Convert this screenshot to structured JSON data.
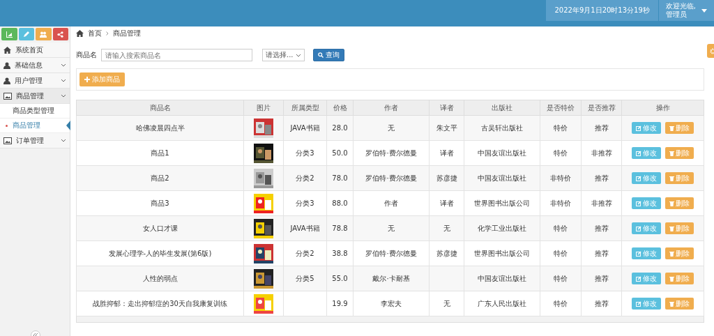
{
  "header": {
    "datetime": "2022年9月1日20时13分19秒",
    "greeting": "欢迎光临,",
    "user": "管理员"
  },
  "sidebar": {
    "shortcuts": [
      {
        "color": "#5cb85c"
      },
      {
        "color": "#5bc0de"
      },
      {
        "color": "#f0ad4e"
      },
      {
        "color": "#d9534f"
      }
    ],
    "menu": [
      {
        "label": "系统首页",
        "kind": "link"
      },
      {
        "label": "基础信息",
        "kind": "group",
        "expanded": false
      },
      {
        "label": "用户管理",
        "kind": "group",
        "expanded": false
      },
      {
        "label": "商品管理",
        "kind": "group",
        "expanded": true,
        "children": [
          {
            "label": "商品类型管理",
            "selected": false
          },
          {
            "label": "商品管理",
            "selected": true
          }
        ]
      },
      {
        "label": "订单管理",
        "kind": "group",
        "expanded": false
      }
    ]
  },
  "breadcrumb": [
    "首页",
    "商品管理"
  ],
  "search": {
    "label": "商品名",
    "placeholder": "请输入搜索商品名",
    "select": "请选择...",
    "button": "查询"
  },
  "add_button": "添加商品",
  "table": {
    "columns": [
      "商品名",
      "图片",
      "所属类型",
      "价格",
      "作者",
      "译者",
      "出版社",
      "是否特价",
      "是否推荐",
      "操作"
    ],
    "rows": [
      {
        "name": "哈佛凌晨四点半",
        "category": "JAVA书籍",
        "price": "28.0",
        "author": "无",
        "translator": "朱文平",
        "publisher": "古吴轩出版社",
        "special": "特价",
        "recommend": "推荐",
        "actions": [
          "修改",
          "删除"
        ]
      },
      {
        "name": "商品1",
        "category": "分类3",
        "price": "50.0",
        "author": "罗伯特·费尔德曼",
        "translator": "译者",
        "publisher": "中国友谊出版社",
        "special": "特价",
        "recommend": "非推荐",
        "actions": [
          "修改",
          "删除"
        ]
      },
      {
        "name": "商品2",
        "category": "分类2",
        "price": "78.0",
        "author": "罗伯特·费尔德曼",
        "translator": "苏彦捷",
        "publisher": "中国友谊出版社",
        "special": "非特价",
        "recommend": "推荐",
        "actions": [
          "修改",
          "删除"
        ]
      },
      {
        "name": "商品3",
        "category": "分类3",
        "price": "88.0",
        "author": "作者",
        "translator": "译者",
        "publisher": "世界图书出版公司",
        "special": "非特价",
        "recommend": "非推荐",
        "actions": [
          "修改",
          "删除"
        ]
      },
      {
        "name": "女人口才课",
        "category": "JAVA书籍",
        "price": "78.8",
        "author": "无",
        "translator": "无",
        "publisher": "化学工业出版社",
        "special": "特价",
        "recommend": "推荐",
        "actions": [
          "修改",
          "删除"
        ]
      },
      {
        "name": "发展心理学-人的毕生发展(第6版)",
        "category": "分类2",
        "price": "38.8",
        "author": "罗伯特·费尔德曼",
        "translator": "苏彦捷",
        "publisher": "世界图书出版公司",
        "special": "特价",
        "recommend": "推荐",
        "actions": [
          "修改",
          "删除"
        ]
      },
      {
        "name": "人性的弱点",
        "category": "分类5",
        "price": "55.0",
        "author": "戴尔·卡耐基",
        "translator": "",
        "publisher": "中国友谊出版社",
        "special": "特价",
        "recommend": "推荐",
        "actions": [
          "修改",
          "删除"
        ]
      },
      {
        "name": "战胜抑郁：走出抑郁症的30天自我康复训练",
        "category": "",
        "price": "19.9",
        "author": "李宏夫",
        "translator": "无",
        "publisher": "广东人民出版社",
        "special": "特价",
        "recommend": "推荐",
        "actions": [
          "修改",
          "删除"
        ]
      }
    ]
  }
}
